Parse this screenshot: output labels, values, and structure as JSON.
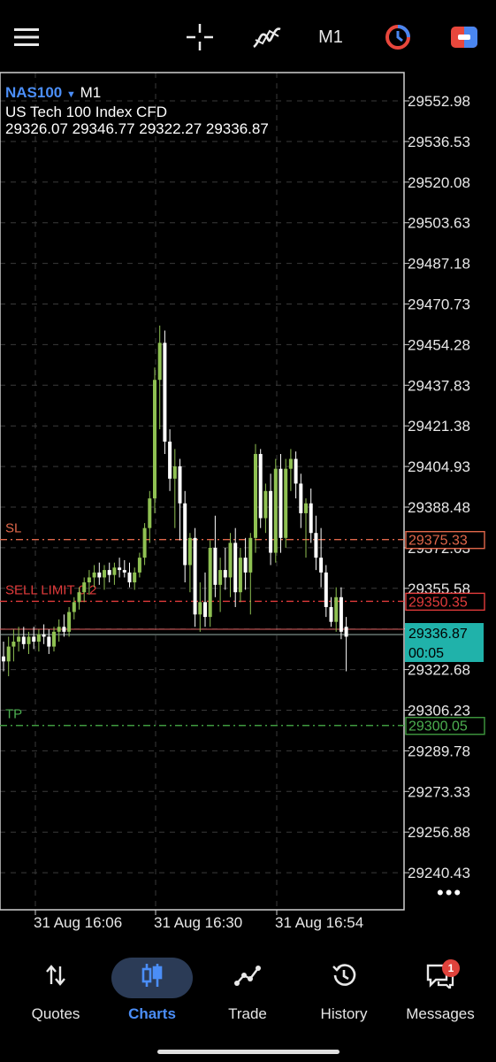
{
  "toolbar": {
    "timeframe": "M1"
  },
  "symbol": {
    "name": "NAS100",
    "timeframe": "M1",
    "description": "US Tech 100 Index CFD",
    "ohlc": "29326.07 29346.77 29322.27 29336.87"
  },
  "price_axis": {
    "ticks": [
      "29552.98",
      "29536.53",
      "29520.08",
      "29503.63",
      "29487.18",
      "29470.73",
      "29454.28",
      "29437.83",
      "29421.38",
      "29404.93",
      "29388.48",
      "29372.03",
      "29355.58",
      "29339.13",
      "29322.68",
      "29306.23",
      "29289.78",
      "29273.33",
      "29256.88",
      "29240.43"
    ]
  },
  "time_axis": {
    "labels": [
      "31 Aug 16:06",
      "31 Aug 16:30",
      "31 Aug 16:54"
    ]
  },
  "levels": {
    "sl": {
      "label": "SL",
      "price": "29375.33",
      "value": 29375.33,
      "color": "#e0674a"
    },
    "sell_limit": {
      "label": "SELL LIMIT 0.2",
      "price": "29350.35",
      "value": 29350.35,
      "color": "#e23b3b"
    },
    "tp": {
      "label": "TP",
      "price": "29300.05",
      "value": 29300.05,
      "color": "#3f9a3f"
    },
    "current": {
      "price": "29336.87",
      "value": 29336.87,
      "countdown": "00:05",
      "color": "#20b2aa"
    }
  },
  "chart_data": {
    "type": "candlestick",
    "y_range": [
      29232,
      29560
    ],
    "candles": [
      [
        29328,
        29334,
        29322,
        29326
      ],
      [
        29326,
        29336,
        29320,
        29332
      ],
      [
        29332,
        29339,
        29326,
        29334
      ],
      [
        29334,
        29340,
        29330,
        29336
      ],
      [
        29336,
        29340,
        29331,
        29333
      ],
      [
        29333,
        29338,
        29329,
        29336
      ],
      [
        29336,
        29340,
        29331,
        29334
      ],
      [
        29334,
        29339,
        29330,
        29337
      ],
      [
        29337,
        29341,
        29333,
        29336
      ],
      [
        29336,
        29339,
        29329,
        29332
      ],
      [
        29332,
        29340,
        29330,
        29338
      ],
      [
        29338,
        29343,
        29334,
        29340
      ],
      [
        29340,
        29345,
        29336,
        29338
      ],
      [
        29338,
        29348,
        29336,
        29346
      ],
      [
        29346,
        29352,
        29343,
        29350
      ],
      [
        29350,
        29356,
        29347,
        29354
      ],
      [
        29354,
        29360,
        29350,
        29358
      ],
      [
        29358,
        29363,
        29353,
        29360
      ],
      [
        29360,
        29365,
        29356,
        29362
      ],
      [
        29362,
        29366,
        29357,
        29360
      ],
      [
        29360,
        29365,
        29355,
        29363
      ],
      [
        29363,
        29366,
        29358,
        29361
      ],
      [
        29361,
        29366,
        29357,
        29364
      ],
      [
        29364,
        29368,
        29360,
        29363
      ],
      [
        29363,
        29367,
        29360,
        29362
      ],
      [
        29362,
        29366,
        29356,
        29358
      ],
      [
        29358,
        29364,
        29355,
        29362
      ],
      [
        29362,
        29370,
        29360,
        29368
      ],
      [
        29368,
        29382,
        29365,
        29380
      ],
      [
        29380,
        29395,
        29374,
        29392
      ],
      [
        29392,
        29445,
        29386,
        29440
      ],
      [
        29440,
        29462,
        29420,
        29455
      ],
      [
        29455,
        29460,
        29410,
        29415
      ],
      [
        29415,
        29420,
        29395,
        29400
      ],
      [
        29400,
        29412,
        29380,
        29405
      ],
      [
        29405,
        29408,
        29375,
        29390
      ],
      [
        29390,
        29395,
        29358,
        29365
      ],
      [
        29365,
        29378,
        29354,
        29376
      ],
      [
        29376,
        29380,
        29340,
        29345
      ],
      [
        29345,
        29358,
        29338,
        29350
      ],
      [
        29350,
        29362,
        29340,
        29344
      ],
      [
        29344,
        29375,
        29340,
        29372
      ],
      [
        29372,
        29385,
        29352,
        29357
      ],
      [
        29357,
        29368,
        29346,
        29363
      ],
      [
        29363,
        29372,
        29355,
        29360
      ],
      [
        29360,
        29378,
        29352,
        29374
      ],
      [
        29374,
        29380,
        29348,
        29354
      ],
      [
        29354,
        29372,
        29350,
        29368
      ],
      [
        29368,
        29376,
        29355,
        29362
      ],
      [
        29362,
        29378,
        29345,
        29376
      ],
      [
        29376,
        29414,
        29370,
        29410
      ],
      [
        29410,
        29412,
        29380,
        29384
      ],
      [
        29384,
        29398,
        29378,
        29395
      ],
      [
        29395,
        29402,
        29365,
        29370
      ],
      [
        29370,
        29408,
        29366,
        29404
      ],
      [
        29404,
        29410,
        29370,
        29376
      ],
      [
        29376,
        29408,
        29372,
        29404
      ],
      [
        29404,
        29412,
        29395,
        29408
      ],
      [
        29408,
        29411,
        29392,
        29398
      ],
      [
        29398,
        29402,
        29380,
        29386
      ],
      [
        29386,
        29392,
        29368,
        29390
      ],
      [
        29390,
        29396,
        29374,
        29378
      ],
      [
        29378,
        29385,
        29363,
        29368
      ],
      [
        29368,
        29380,
        29356,
        29362
      ],
      [
        29362,
        29365,
        29344,
        29348
      ],
      [
        29348,
        29352,
        29340,
        29342
      ],
      [
        29342,
        29356,
        29338,
        29352
      ],
      [
        29352,
        29356,
        29335,
        29338
      ],
      [
        29340,
        29344,
        29322,
        29336
      ]
    ]
  },
  "nav": {
    "items": [
      {
        "label": "Quotes"
      },
      {
        "label": "Charts"
      },
      {
        "label": "Trade"
      },
      {
        "label": "History"
      },
      {
        "label": "Messages"
      }
    ],
    "badge": "1"
  }
}
